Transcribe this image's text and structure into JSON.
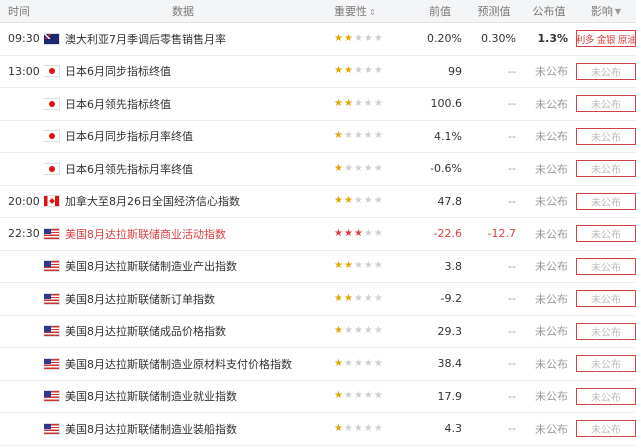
{
  "header": {
    "time": "时间",
    "data": "数据",
    "importance": "重要性",
    "previous": "前值",
    "forecast": "预测值",
    "actual": "公布值",
    "impact": "影响"
  },
  "rows": [
    {
      "time": "09:30",
      "flag": "au",
      "name": "澳大利亚7月季调后零售销售月率",
      "stars": 2,
      "prev": "0.20%",
      "fore": "0.30%",
      "act": "1.3%",
      "impact": "利多 金银 原油"
    },
    {
      "time": "13:00",
      "flag": "jp",
      "name": "日本6月同步指标终值",
      "stars": 2,
      "prev": "99",
      "fore": "--",
      "act": "未公布",
      "impact": "未公布"
    },
    {
      "time": "",
      "flag": "jp",
      "name": "日本6月领先指标终值",
      "stars": 2,
      "prev": "100.6",
      "fore": "--",
      "act": "未公布",
      "impact": "未公布"
    },
    {
      "time": "",
      "flag": "jp",
      "name": "日本6月同步指标月率终值",
      "stars": 1,
      "prev": "4.1%",
      "fore": "--",
      "act": "未公布",
      "impact": "未公布"
    },
    {
      "time": "",
      "flag": "jp",
      "name": "日本6月领先指标月率终值",
      "stars": 1,
      "prev": "-0.6%",
      "fore": "--",
      "act": "未公布",
      "impact": "未公布"
    },
    {
      "time": "20:00",
      "flag": "ca",
      "name": "加拿大至8月26日全国经济信心指数",
      "stars": 2,
      "prev": "47.8",
      "fore": "--",
      "act": "未公布",
      "impact": "未公布"
    },
    {
      "time": "22:30",
      "flag": "us",
      "name": "美国8月达拉斯联储商业活动指数",
      "stars": 3,
      "prev": "-22.6",
      "fore": "-12.7",
      "act": "未公布",
      "impact": "未公布",
      "highlight": true
    },
    {
      "time": "",
      "flag": "us",
      "name": "美国8月达拉斯联储制造业产出指数",
      "stars": 2,
      "prev": "3.8",
      "fore": "--",
      "act": "未公布",
      "impact": "未公布"
    },
    {
      "time": "",
      "flag": "us",
      "name": "美国8月达拉斯联储新订单指数",
      "stars": 2,
      "prev": "-9.2",
      "fore": "--",
      "act": "未公布",
      "impact": "未公布"
    },
    {
      "time": "",
      "flag": "us",
      "name": "美国8月达拉斯联储成品价格指数",
      "stars": 1,
      "prev": "29.3",
      "fore": "--",
      "act": "未公布",
      "impact": "未公布"
    },
    {
      "time": "",
      "flag": "us",
      "name": "美国8月达拉斯联储制造业原材料支付价格指数",
      "stars": 1,
      "prev": "38.4",
      "fore": "--",
      "act": "未公布",
      "impact": "未公布"
    },
    {
      "time": "",
      "flag": "us",
      "name": "美国8月达拉斯联储制造业就业指数",
      "stars": 1,
      "prev": "17.9",
      "fore": "--",
      "act": "未公布",
      "impact": "未公布"
    },
    {
      "time": "",
      "flag": "us",
      "name": "美国8月达拉斯联储制造业装船指数",
      "stars": 1,
      "prev": "4.3",
      "fore": "--",
      "act": "未公布",
      "impact": "未公布"
    }
  ]
}
